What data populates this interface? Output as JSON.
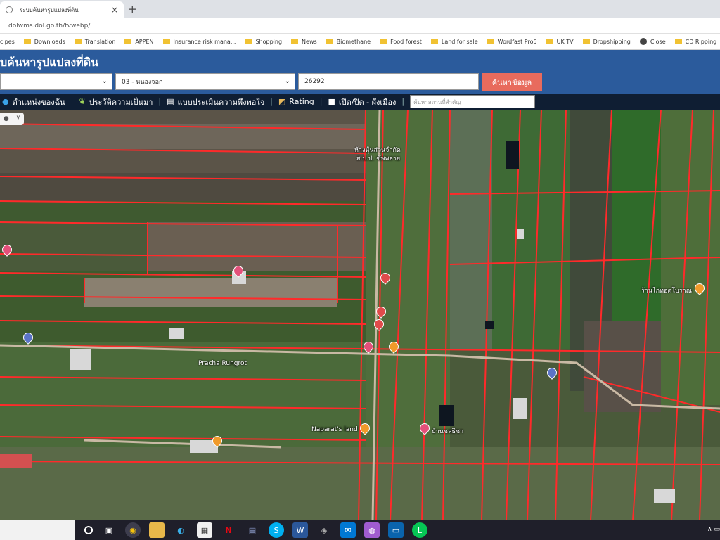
{
  "browser": {
    "tab_title": "ระบบค้นหารูปแปลงที่ดิน",
    "new_tab": "+",
    "close_tab": "×",
    "url": "dolwms.dol.go.th/tvwebp/"
  },
  "bookmarks": [
    {
      "label": "cipes",
      "icon": "folder-icon"
    },
    {
      "label": "Downloads",
      "icon": "folder-icon"
    },
    {
      "label": "Translation",
      "icon": "folder-icon"
    },
    {
      "label": "APPEN",
      "icon": "folder-icon"
    },
    {
      "label": "Insurance risk mana...",
      "icon": "folder-icon"
    },
    {
      "label": "Shopping",
      "icon": "folder-icon"
    },
    {
      "label": "News",
      "icon": "folder-icon"
    },
    {
      "label": "Biomethane",
      "icon": "folder-icon"
    },
    {
      "label": "Food forest",
      "icon": "folder-icon"
    },
    {
      "label": "Land for sale",
      "icon": "folder-icon"
    },
    {
      "label": "Wordfast Pro5",
      "icon": "folder-icon"
    },
    {
      "label": "UK TV",
      "icon": "folder-icon"
    },
    {
      "label": "Dropshipping",
      "icon": "folder-icon"
    },
    {
      "label": "Close",
      "icon": "globe-icon"
    },
    {
      "label": "CD Ripping",
      "icon": "folder-icon"
    }
  ],
  "header": {
    "title": "บค้นหารูปแปลงที่ดิน",
    "district_value": "03 - หนองจอก",
    "parcel_value": "26292",
    "search_button": "ค้นหาข้อมูล"
  },
  "toolbar": {
    "my_location": "ตำแหน่งของฉัน",
    "history": "ประวัติความเป็นมา",
    "survey": "แบบประเมินความพึงพอใจ",
    "rating": "Rating",
    "toggle": "เปิด/ปิด - ผังเมือง",
    "place_search_placeholder": "ค้นหาสถานที่สำคัญ"
  },
  "map": {
    "labels": [
      {
        "text": "ห้างหุ้นส่วนจำกัด"
      },
      {
        "text": "ส.ป.ป. ซัพพลาย"
      },
      {
        "text": "Naparat's land"
      },
      {
        "text": "Pracha Rungrot"
      },
      {
        "text": "ร้านไก่ทอดโบราณ"
      },
      {
        "text": "บ้านชลธิชา"
      }
    ]
  },
  "colors": {
    "header_bg": "#2b5b9c",
    "toolbar_bg": "#0f1e33",
    "search_button": "#e86b5d",
    "parcel_lines": "#ff2a2a"
  }
}
